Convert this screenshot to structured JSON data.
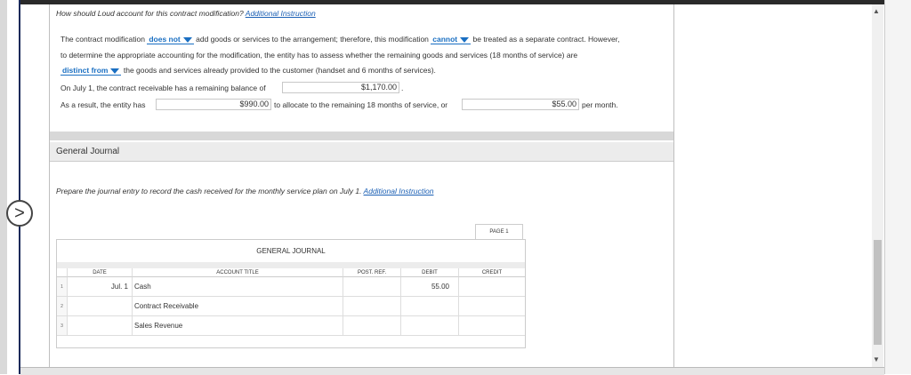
{
  "question1": {
    "text": "How should Loud account for this contract modification?",
    "link": "Additional Instruction"
  },
  "paragraph": {
    "l1_a": "The contract modification",
    "dd1": "does not",
    "l1_b": "add goods or services to the arrangement; therefore, this modification",
    "dd2": "cannot",
    "l1_c": "be treated as a separate contract. However,",
    "l2": "to determine the appropriate accounting for the modification, the entity has to assess whether the remaining goods and services (18 months of service) are",
    "dd3": "distinct from",
    "l3": "the goods and services already provided to the customer (handset and 6 months of services).",
    "l4_label": "On July 1, the contract receivable has a remaining balance of",
    "l4_value": "$1,170.00",
    "l5_label": "As a result, the entity has",
    "l5_value": "$990.00",
    "l5_mid": "to allocate to the remaining 18 months of service, or",
    "l5_value2": "$55.00",
    "l5_end": "per month."
  },
  "general_journal": {
    "section_title": "General Journal",
    "question": "Prepare the journal entry to record the cash received for the monthly service plan on July 1.",
    "link": "Additional Instruction",
    "page_label": "PAGE 1",
    "table_title": "GENERAL JOURNAL",
    "headers": {
      "date": "DATE",
      "account": "ACCOUNT TITLE",
      "post_ref": "POST. REF.",
      "debit": "DEBIT",
      "credit": "CREDIT"
    },
    "rows": [
      {
        "num": "1",
        "date": "Jul. 1",
        "account": "Cash",
        "post_ref": "",
        "debit": "55.00",
        "credit": ""
      },
      {
        "num": "2",
        "date": "",
        "account": "Contract Receivable",
        "post_ref": "",
        "debit": "",
        "credit": ""
      },
      {
        "num": "3",
        "date": "",
        "account": "Sales Revenue",
        "post_ref": "",
        "debit": "",
        "credit": ""
      }
    ]
  },
  "icons": {
    "nav": "chevron-right-icon",
    "scroll_up": "triangle-up-icon",
    "scroll_down": "triangle-down-icon"
  }
}
